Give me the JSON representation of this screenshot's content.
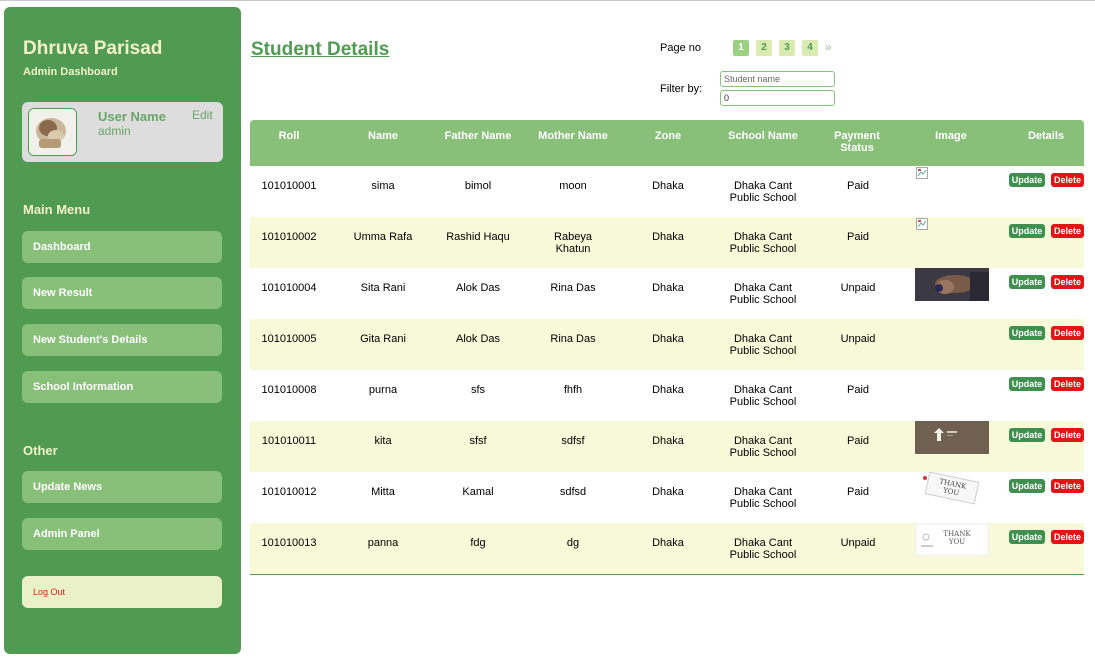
{
  "sidebar": {
    "brand": "Dhruva Parisad",
    "subtitle": "Admin Dashboard",
    "user": {
      "name": "User Name",
      "role": "admin",
      "edit_label": "Edit"
    },
    "main_menu_heading": "Main Menu",
    "main_menu": [
      "Dashboard",
      "New Result",
      "New Student's Details",
      "School Information"
    ],
    "other_heading": "Other",
    "other_menu": [
      "Update News",
      "Admin Panel"
    ],
    "logout_label": "Log Out"
  },
  "main": {
    "title": "Student Details",
    "page_label": "Page no",
    "pages": [
      "1",
      "2",
      "3",
      "4"
    ],
    "current_page": "1",
    "next_glyph": "»",
    "filter_label": "Filter by:",
    "filter_name_placeholder": "Student name",
    "filter_value": "0"
  },
  "table": {
    "columns": [
      "Roll",
      "Name",
      "Father Name",
      "Mother Name",
      "Zone",
      "School Name",
      "Payment Status",
      "Image",
      "Details"
    ],
    "update_label": "Update",
    "delete_label": "Delete",
    "rows": [
      {
        "roll": "101010001",
        "name": "sima",
        "father": "bimol",
        "mother": "moon",
        "zone": "Dhaka",
        "school": "Dhaka Cant Public School",
        "payment": "Paid",
        "image": "broken"
      },
      {
        "roll": "101010002",
        "name": "Umma Rafa",
        "father": "Rashid Haqu",
        "mother": "Rabeya Khatun",
        "zone": "Dhaka",
        "school": "Dhaka Cant Public School",
        "payment": "Paid",
        "image": "broken"
      },
      {
        "roll": "101010004",
        "name": "Sita Rani",
        "father": "Alok Das",
        "mother": "Rina Das",
        "zone": "Dhaka",
        "school": "Dhaka Cant Public School",
        "payment": "Unpaid",
        "image": "hands-photo"
      },
      {
        "roll": "101010005",
        "name": "Gita Rani",
        "father": "Alok Das",
        "mother": "Rina Das",
        "zone": "Dhaka",
        "school": "Dhaka Cant Public School",
        "payment": "Unpaid",
        "image": "none"
      },
      {
        "roll": "101010008",
        "name": "purna",
        "father": "sfs",
        "mother": "fhfh",
        "zone": "Dhaka",
        "school": "Dhaka Cant Public School",
        "payment": "Paid",
        "image": "none"
      },
      {
        "roll": "101010011",
        "name": "kita",
        "father": "sfsf",
        "mother": "sdfsf",
        "zone": "Dhaka",
        "school": "Dhaka Cant Public School",
        "payment": "Paid",
        "image": "arrow-board"
      },
      {
        "roll": "101010012",
        "name": "Mitta",
        "father": "Kamal",
        "mother": "sdfsd",
        "zone": "Dhaka",
        "school": "Dhaka Cant Public School",
        "payment": "Paid",
        "image": "thank-you-note"
      },
      {
        "roll": "101010013",
        "name": "panna",
        "father": "fdg",
        "mother": "dg",
        "zone": "Dhaka",
        "school": "Dhaka Cant Public School",
        "payment": "Unpaid",
        "image": "thank-you-card"
      }
    ]
  },
  "colors": {
    "sidebar_bg": "#519a51",
    "menu_button": "#88c07a",
    "accent_text": "#f2f2c7",
    "row_alt": "#f7f9d9",
    "update_button": "#3f8f4f",
    "delete_button": "#e01515"
  }
}
